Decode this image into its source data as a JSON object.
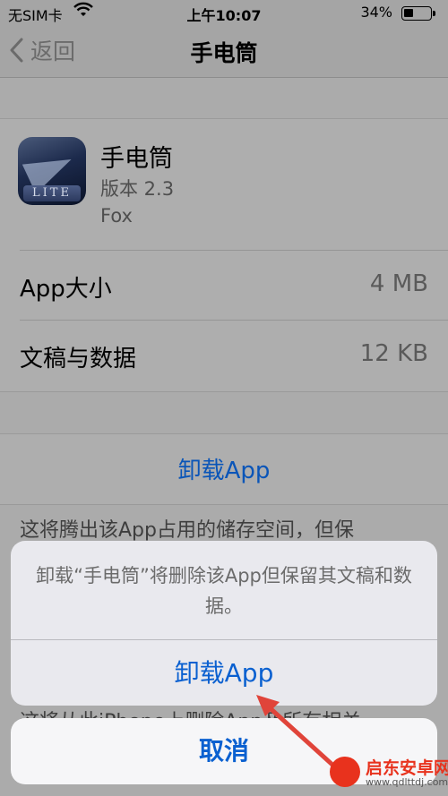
{
  "status_bar": {
    "carrier": "无SIM卡",
    "time": "上午10:07",
    "battery": "34%"
  },
  "nav": {
    "back_label": "返回",
    "title": "手电筒"
  },
  "app": {
    "name": "手电筒",
    "version": "版本 2.3",
    "vendor": "Fox",
    "icon_text": "LITE"
  },
  "rows": [
    {
      "label": "App大小",
      "value": "4 MB"
    },
    {
      "label": "文稿与数据",
      "value": "12 KB"
    }
  ],
  "offload": {
    "link": "卸载App",
    "footnote": "这将腾出该App占用的储存空间，但保",
    "footnote2": "这将从此iPhone上删除App及所有相关"
  },
  "action_sheet": {
    "message": "卸载“手电筒”将删除该App但保留其文稿和数据。",
    "action": "卸载App",
    "cancel": "取消"
  },
  "watermark": {
    "text": "启东安卓网",
    "url": "www.qdlttdj.com"
  },
  "colors": {
    "accent": "#0a60d0",
    "annotation_arrow": "#e0443a"
  }
}
